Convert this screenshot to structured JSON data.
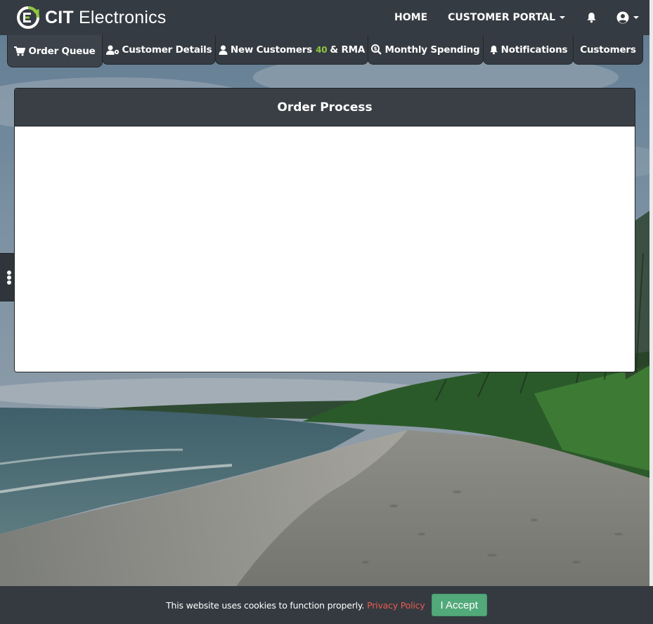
{
  "brand": {
    "name_bold": "CIT",
    "name_rest": " Electronics",
    "logo_icon": "cit-logo-icon",
    "accent_color": "#8dc63f"
  },
  "nav": {
    "home": "HOME",
    "customer_portal": "CUSTOMER PORTAL",
    "bell_icon": "bell-icon",
    "user_icon": "user-circle-icon"
  },
  "tabs": [
    {
      "label": "Order Queue",
      "icon": "cart-icon",
      "active": true
    },
    {
      "label": "Customer Details",
      "icon": "user-gear-icon"
    },
    {
      "label_before": "New Customers",
      "count": "40",
      "label_after": "& RMA",
      "icon": "user-icon"
    },
    {
      "label": "Monthly Spending",
      "icon": "magnify-dollar-icon"
    },
    {
      "label": "Notifications",
      "icon": "bell-icon"
    },
    {
      "label": "Customers"
    }
  ],
  "card": {
    "title": "Order Process"
  },
  "cookie": {
    "text": "This website uses cookies to function properly.",
    "link": "Privacy Policy",
    "accept": "I Accept",
    "link_color": "#ea5a4f",
    "accept_color": "#52a97a"
  }
}
